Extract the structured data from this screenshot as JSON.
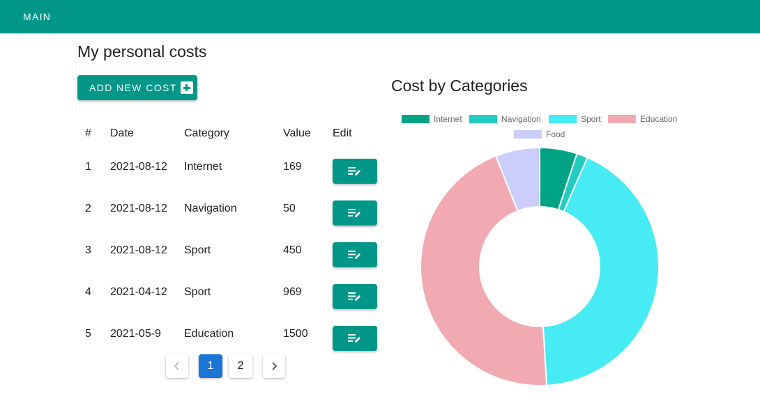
{
  "nav": {
    "main_label": "MAIN",
    "color": "#009688"
  },
  "page": {
    "title": "My personal costs",
    "add_button_label": "ADD NEW COST"
  },
  "table": {
    "headers": [
      "#",
      "Date",
      "Category",
      "Value",
      "Edit"
    ],
    "rows": [
      {
        "num": "1",
        "date": "2021-08-12",
        "category": "Internet",
        "value": "169"
      },
      {
        "num": "2",
        "date": "2021-08-12",
        "category": "Navigation",
        "value": "50"
      },
      {
        "num": "3",
        "date": "2021-08-12",
        "category": "Sport",
        "value": "450"
      },
      {
        "num": "4",
        "date": "2021-04-12",
        "category": "Sport",
        "value": "969"
      },
      {
        "num": "5",
        "date": "2021-05-9",
        "category": "Education",
        "value": "1500"
      }
    ]
  },
  "pagination": {
    "pages": [
      "1",
      "2"
    ],
    "current": "1",
    "prev_icon": "chevron-left-icon",
    "next_icon": "chevron-right-icon"
  },
  "chart_data": {
    "type": "pie",
    "variant": "doughnut",
    "title": "Cost by Categories",
    "legend_position": "top",
    "categories": [
      "Internet",
      "Navigation",
      "Sport",
      "Education",
      "Food"
    ],
    "values": [
      169,
      50,
      1419,
      1500,
      200
    ],
    "colors": [
      "#00a383",
      "#21cdc0",
      "#46ebf3",
      "#f1aab1",
      "#cbcdfa"
    ]
  }
}
